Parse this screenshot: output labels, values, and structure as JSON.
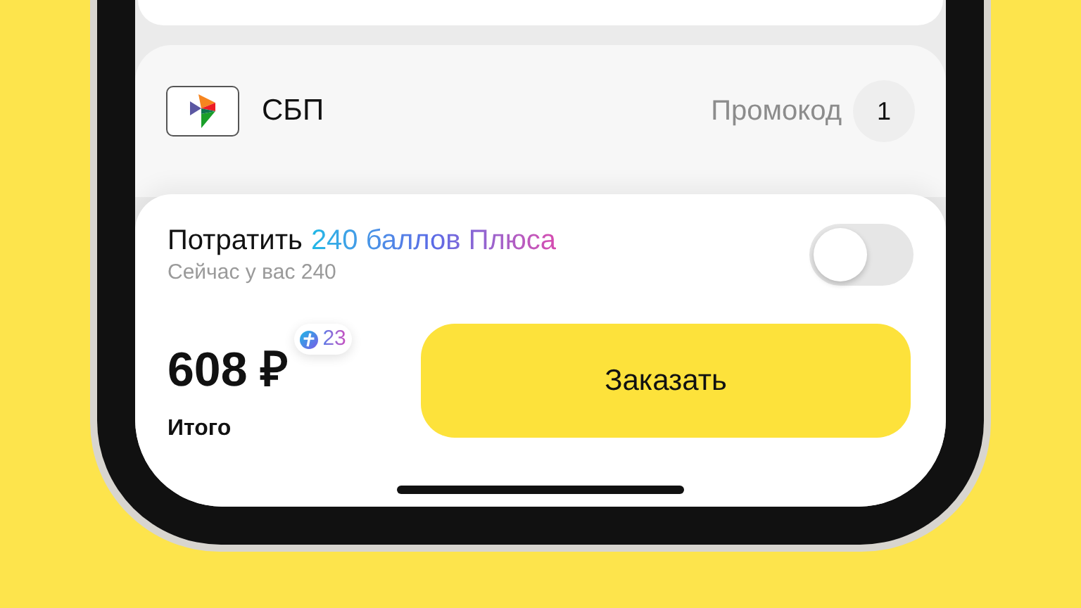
{
  "payment": {
    "method": "СБП",
    "promo_label": "Промокод",
    "promo_count": "1"
  },
  "points": {
    "title_prefix": "Потратить",
    "title_highlight": "240 баллов Плюса",
    "subtitle": "Сейчас у вас 240",
    "on": false
  },
  "total": {
    "amount": "608 ₽",
    "cashback": "23",
    "label": "Итого"
  },
  "order_button": "Заказать"
}
